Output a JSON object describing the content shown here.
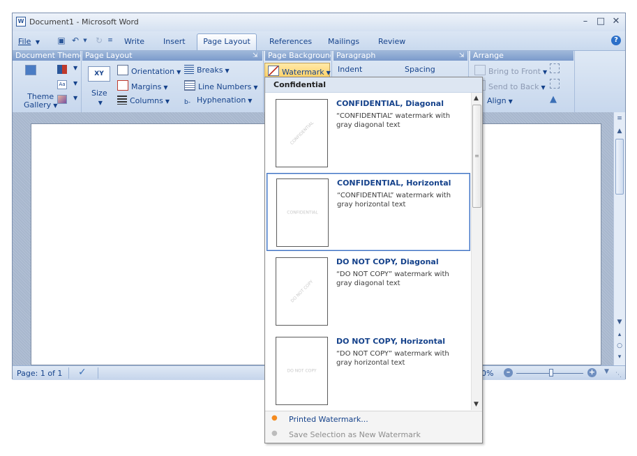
{
  "window": {
    "title": "Document1 - Microsoft Word",
    "doc_icon_letter": "W"
  },
  "menubar": {
    "file_label": "File",
    "tabs": [
      "Write",
      "Insert",
      "Page Layout",
      "References",
      "Mailings",
      "Review"
    ],
    "active_tab": "Page Layout"
  },
  "ribbon": {
    "groups": {
      "document_themes": "Document Theme",
      "page_layout": "Page Layout",
      "page_background": "Page Background",
      "paragraph": "Paragraph",
      "arrange": "Arrange"
    },
    "theme_gallery": {
      "line1": "Theme",
      "line2": "Gallery"
    },
    "size_label": "Size",
    "orientation": "Orientation",
    "margins": "Margins",
    "columns": "Columns",
    "breaks": "Breaks",
    "line_numbers": "Line Numbers",
    "hyphenation": "Hyphenation",
    "watermark": "Watermark",
    "indent": "Indent",
    "spacing": "Spacing",
    "bring_to_front": "Bring to Front",
    "send_to_back": "Send to Back",
    "align": "Align"
  },
  "statusbar": {
    "page_count": "Page: 1 of 1",
    "zoom_percent": "0%"
  },
  "gallery": {
    "category": "Confidential",
    "items": [
      {
        "title": "CONFIDENTIAL, Diagonal",
        "description": "“CONFIDENTIAL” watermark with gray diagonal text",
        "thumb_text": "CONFIDENTIAL",
        "orientation": "diagonal"
      },
      {
        "title": "CONFIDENTIAL, Horizontal",
        "description": "“CONFIDENTIAL” watermark with gray horizontal text",
        "thumb_text": "CONFIDENTIAL",
        "orientation": "horizontal"
      },
      {
        "title": "DO NOT COPY, Diagonal",
        "description": "“DO NOT COPY” watermark with gray diagonal text",
        "thumb_text": "DO NOT COPY",
        "orientation": "diagonal"
      },
      {
        "title": "DO NOT COPY, Horizontal",
        "description": "“DO NOT COPY” watermark with gray horizontal text",
        "thumb_text": "DO NOT COPY",
        "orientation": "horizontal"
      }
    ],
    "selected_index": 1,
    "footer": {
      "printed_watermark": "Printed Watermark...",
      "save_selection": "Save Selection as New Watermark"
    }
  },
  "colors": {
    "accent": "#15428b",
    "selection_border": "#3d6fbe",
    "bullet_active": "#f58b1f",
    "disabled_text": "#8d8d8d"
  }
}
